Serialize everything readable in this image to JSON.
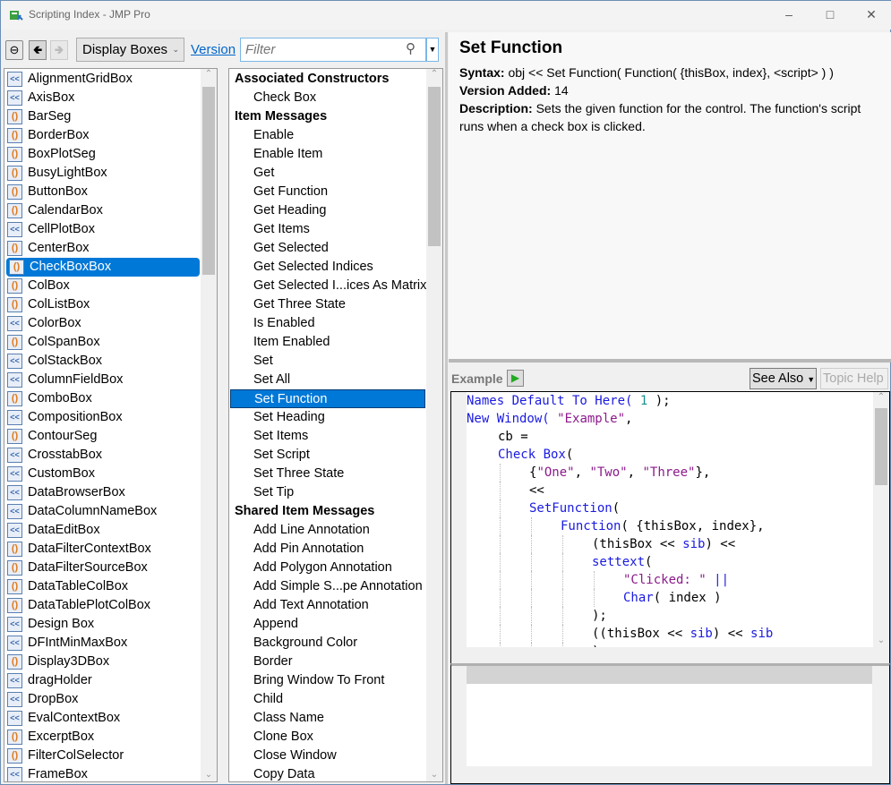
{
  "window": {
    "title": "Scripting Index - JMP Pro"
  },
  "toolbar": {
    "category": "Display Boxes",
    "version_link": "Version",
    "filter_placeholder": "Filter"
  },
  "left_list": {
    "selected": "CheckBoxBox",
    "items": [
      {
        "label": "AlignmentGridBox",
        "icon": "method"
      },
      {
        "label": "AxisBox",
        "icon": "method"
      },
      {
        "label": "BarSeg",
        "icon": "function"
      },
      {
        "label": "BorderBox",
        "icon": "function"
      },
      {
        "label": "BoxPlotSeg",
        "icon": "function"
      },
      {
        "label": "BusyLightBox",
        "icon": "function"
      },
      {
        "label": "ButtonBox",
        "icon": "function"
      },
      {
        "label": "CalendarBox",
        "icon": "function"
      },
      {
        "label": "CellPlotBox",
        "icon": "method"
      },
      {
        "label": "CenterBox",
        "icon": "function"
      },
      {
        "label": "CheckBoxBox",
        "icon": "function"
      },
      {
        "label": "ColBox",
        "icon": "function"
      },
      {
        "label": "ColListBox",
        "icon": "function"
      },
      {
        "label": "ColorBox",
        "icon": "method"
      },
      {
        "label": "ColSpanBox",
        "icon": "function"
      },
      {
        "label": "ColStackBox",
        "icon": "method"
      },
      {
        "label": "ColumnFieldBox",
        "icon": "method"
      },
      {
        "label": "ComboBox",
        "icon": "function"
      },
      {
        "label": "CompositionBox",
        "icon": "method"
      },
      {
        "label": "ContourSeg",
        "icon": "function"
      },
      {
        "label": "CrosstabBox",
        "icon": "method"
      },
      {
        "label": "CustomBox",
        "icon": "method"
      },
      {
        "label": "DataBrowserBox",
        "icon": "method"
      },
      {
        "label": "DataColumnNameBox",
        "icon": "method"
      },
      {
        "label": "DataEditBox",
        "icon": "method"
      },
      {
        "label": "DataFilterContextBox",
        "icon": "function"
      },
      {
        "label": "DataFilterSourceBox",
        "icon": "function"
      },
      {
        "label": "DataTableColBox",
        "icon": "function"
      },
      {
        "label": "DataTablePlotColBox",
        "icon": "function"
      },
      {
        "label": "Design Box",
        "icon": "method"
      },
      {
        "label": "DFIntMinMaxBox",
        "icon": "method"
      },
      {
        "label": "Display3DBox",
        "icon": "function"
      },
      {
        "label": "dragHolder",
        "icon": "method"
      },
      {
        "label": "DropBox",
        "icon": "method"
      },
      {
        "label": "EvalContextBox",
        "icon": "method"
      },
      {
        "label": "ExcerptBox",
        "icon": "function"
      },
      {
        "label": "FilterColSelector",
        "icon": "function"
      },
      {
        "label": "FrameBox",
        "icon": "method"
      }
    ]
  },
  "mid_list": {
    "selected": "Set Function",
    "items": [
      {
        "label": "Associated Constructors",
        "header": true
      },
      {
        "label": "Check Box"
      },
      {
        "label": "Item Messages",
        "header": true
      },
      {
        "label": "Enable"
      },
      {
        "label": "Enable Item"
      },
      {
        "label": "Get"
      },
      {
        "label": "Get Function"
      },
      {
        "label": "Get Heading"
      },
      {
        "label": "Get Items"
      },
      {
        "label": "Get Selected"
      },
      {
        "label": "Get Selected Indices"
      },
      {
        "label": "Get Selected I...ices As Matrix"
      },
      {
        "label": "Get Three State"
      },
      {
        "label": "Is Enabled"
      },
      {
        "label": "Item Enabled"
      },
      {
        "label": "Set"
      },
      {
        "label": "Set All"
      },
      {
        "label": "Set Function"
      },
      {
        "label": "Set Heading"
      },
      {
        "label": "Set Items"
      },
      {
        "label": "Set Script"
      },
      {
        "label": "Set Three State"
      },
      {
        "label": "Set Tip"
      },
      {
        "label": "Shared Item Messages",
        "header": true
      },
      {
        "label": "Add Line Annotation"
      },
      {
        "label": "Add Pin Annotation"
      },
      {
        "label": "Add Polygon Annotation"
      },
      {
        "label": "Add Simple S...pe Annotation"
      },
      {
        "label": "Add Text Annotation"
      },
      {
        "label": "Append"
      },
      {
        "label": "Background Color"
      },
      {
        "label": "Border"
      },
      {
        "label": "Bring Window To Front"
      },
      {
        "label": "Child"
      },
      {
        "label": "Class Name"
      },
      {
        "label": "Clone Box"
      },
      {
        "label": "Close Window"
      },
      {
        "label": "Copy Data"
      }
    ]
  },
  "detail": {
    "title": "Set Function",
    "syntax_label": "Syntax:",
    "syntax": "obj << Set Function( Function( {thisBox, index}, <script> ) )",
    "version_label": "Version Added:",
    "version": "14",
    "description_label": "Description:",
    "description": "Sets the given function for the control. The function's script runs when a check box is clicked."
  },
  "example": {
    "label": "Example",
    "see_also": "See Also",
    "topic_help": "Topic Help",
    "code": [
      {
        "indent": 0,
        "tokens": [
          [
            "kw",
            "Names Default To Here( "
          ],
          [
            "nm",
            "1"
          ],
          [
            "tx",
            " );"
          ]
        ]
      },
      {
        "indent": 0,
        "tokens": [
          [
            "kw",
            "New Window( "
          ],
          [
            "st",
            "\"Example\""
          ],
          [
            "tx",
            ","
          ]
        ]
      },
      {
        "indent": 1,
        "tokens": [
          [
            "tx",
            "cb ="
          ]
        ]
      },
      {
        "indent": 1,
        "tokens": [
          [
            "kw",
            "Check Box"
          ],
          [
            "tx",
            "("
          ]
        ]
      },
      {
        "indent": 2,
        "tokens": [
          [
            "tx",
            "{"
          ],
          [
            "st",
            "\"One\""
          ],
          [
            "tx",
            ", "
          ],
          [
            "st",
            "\"Two\""
          ],
          [
            "tx",
            ", "
          ],
          [
            "st",
            "\"Three\""
          ],
          [
            "tx",
            "},"
          ]
        ]
      },
      {
        "indent": 2,
        "tokens": [
          [
            "tx",
            "<<"
          ]
        ]
      },
      {
        "indent": 2,
        "tokens": [
          [
            "kw",
            "SetFunction"
          ],
          [
            "tx",
            "("
          ]
        ]
      },
      {
        "indent": 3,
        "tokens": [
          [
            "kw",
            "Function"
          ],
          [
            "tx",
            "( {thisBox, index},"
          ]
        ]
      },
      {
        "indent": 4,
        "tokens": [
          [
            "tx",
            "(thisBox << "
          ],
          [
            "kw",
            "sib"
          ],
          [
            "tx",
            ") <<"
          ]
        ]
      },
      {
        "indent": 4,
        "tokens": [
          [
            "kw",
            "settext"
          ],
          [
            "tx",
            "("
          ]
        ]
      },
      {
        "indent": 5,
        "tokens": [
          [
            "st",
            "\"Clicked: \""
          ],
          [
            "tx",
            " "
          ],
          [
            "kw",
            "||"
          ]
        ]
      },
      {
        "indent": 5,
        "tokens": [
          [
            "kw",
            "Char"
          ],
          [
            "tx",
            "( index )"
          ]
        ]
      },
      {
        "indent": 4,
        "tokens": [
          [
            "tx",
            ");"
          ]
        ]
      },
      {
        "indent": 4,
        "tokens": [
          [
            "tx",
            "((thisBox << "
          ],
          [
            "kw",
            "sib"
          ],
          [
            "tx",
            ") << "
          ],
          [
            "kw",
            "sib"
          ]
        ]
      },
      {
        "indent": 4,
        "tokens": [
          [
            "tx",
            ")"
          ]
        ]
      }
    ]
  },
  "colors": {
    "selection": "#0078d7",
    "keyword": "#1a1ae0",
    "string": "#8b1a8b",
    "number": "#1a9090",
    "link": "#0066cc"
  }
}
